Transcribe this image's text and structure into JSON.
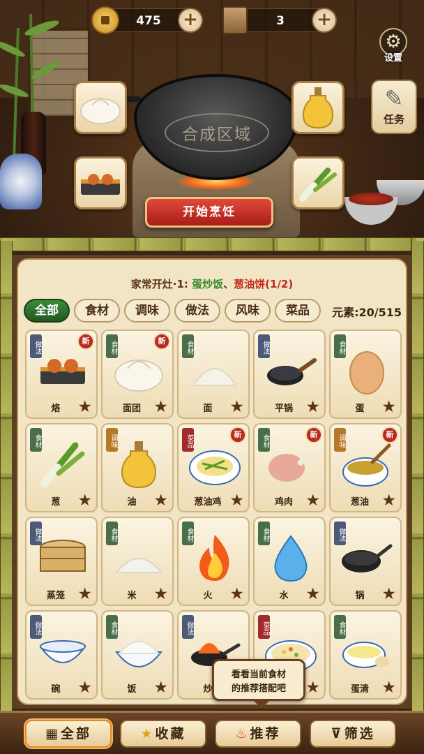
{
  "hud": {
    "coins": "475",
    "scrolls": "3",
    "settings_label": "设置",
    "task_label": "任务"
  },
  "synthesis": {
    "area_label": "合成区域",
    "start_button": "开始烹饪",
    "slots": [
      "面团",
      "油",
      "烙",
      "葱"
    ]
  },
  "quest": {
    "prefix": "家常开灶·1: ",
    "item_done": "蛋炒饭",
    "separator": "、",
    "item_todo": "葱油饼(1/2)"
  },
  "tabs": [
    "全部",
    "食材",
    "调味",
    "做法",
    "风味",
    "菜品"
  ],
  "element_count": "元素:20/515",
  "category_labels": {
    "ingredient": "食材",
    "method": "做法",
    "seasoning": "调味",
    "dish": "菜品"
  },
  "new_badge": "新",
  "cards": [
    {
      "name": "烙",
      "cat": "method",
      "new": true,
      "icon": "griddle-icon"
    },
    {
      "name": "面团",
      "cat": "ingredient",
      "new": true,
      "icon": "dough-icon"
    },
    {
      "name": "面",
      "cat": "ingredient",
      "new": false,
      "icon": "flour-icon"
    },
    {
      "name": "平锅",
      "cat": "method",
      "new": false,
      "icon": "flat-pan-icon"
    },
    {
      "name": "蛋",
      "cat": "ingredient",
      "new": false,
      "icon": "egg-icon"
    },
    {
      "name": "葱",
      "cat": "ingredient",
      "new": false,
      "icon": "scallion-icon"
    },
    {
      "name": "油",
      "cat": "seasoning",
      "new": false,
      "icon": "oil-icon"
    },
    {
      "name": "葱油鸡",
      "cat": "dish",
      "new": true,
      "icon": "scallion-chicken-icon"
    },
    {
      "name": "鸡肉",
      "cat": "ingredient",
      "new": true,
      "icon": "chicken-leg-icon"
    },
    {
      "name": "葱油",
      "cat": "seasoning",
      "new": true,
      "icon": "scallion-oil-icon"
    },
    {
      "name": "蒸笼",
      "cat": "method",
      "new": false,
      "icon": "steamer-icon"
    },
    {
      "name": "米",
      "cat": "ingredient",
      "new": false,
      "icon": "rice-icon"
    },
    {
      "name": "火",
      "cat": "ingredient",
      "new": false,
      "icon": "fire-icon"
    },
    {
      "name": "水",
      "cat": "ingredient",
      "new": false,
      "icon": "water-icon"
    },
    {
      "name": "锅",
      "cat": "method",
      "new": false,
      "icon": "wok-icon"
    },
    {
      "name": "碗",
      "cat": "method",
      "new": false,
      "icon": "bowl-icon"
    },
    {
      "name": "饭",
      "cat": "ingredient",
      "new": false,
      "icon": "cooked-rice-icon"
    },
    {
      "name": "炒",
      "cat": "method",
      "new": false,
      "icon": "stir-fry-icon"
    },
    {
      "name": "蛋炒饭",
      "cat": "dish",
      "new": false,
      "icon": "fried-rice-icon"
    },
    {
      "name": "蛋清",
      "cat": "ingredient",
      "new": false,
      "icon": "egg-white-icon"
    }
  ],
  "tooltip": "看看当前食材\n的推荐搭配吧",
  "bottom_nav": [
    {
      "label": "全部",
      "icon": "grid-icon"
    },
    {
      "label": "收藏",
      "icon": "star-icon"
    },
    {
      "label": "推荐",
      "icon": "flame-icon"
    },
    {
      "label": "筛选",
      "icon": "filter-icon"
    }
  ]
}
